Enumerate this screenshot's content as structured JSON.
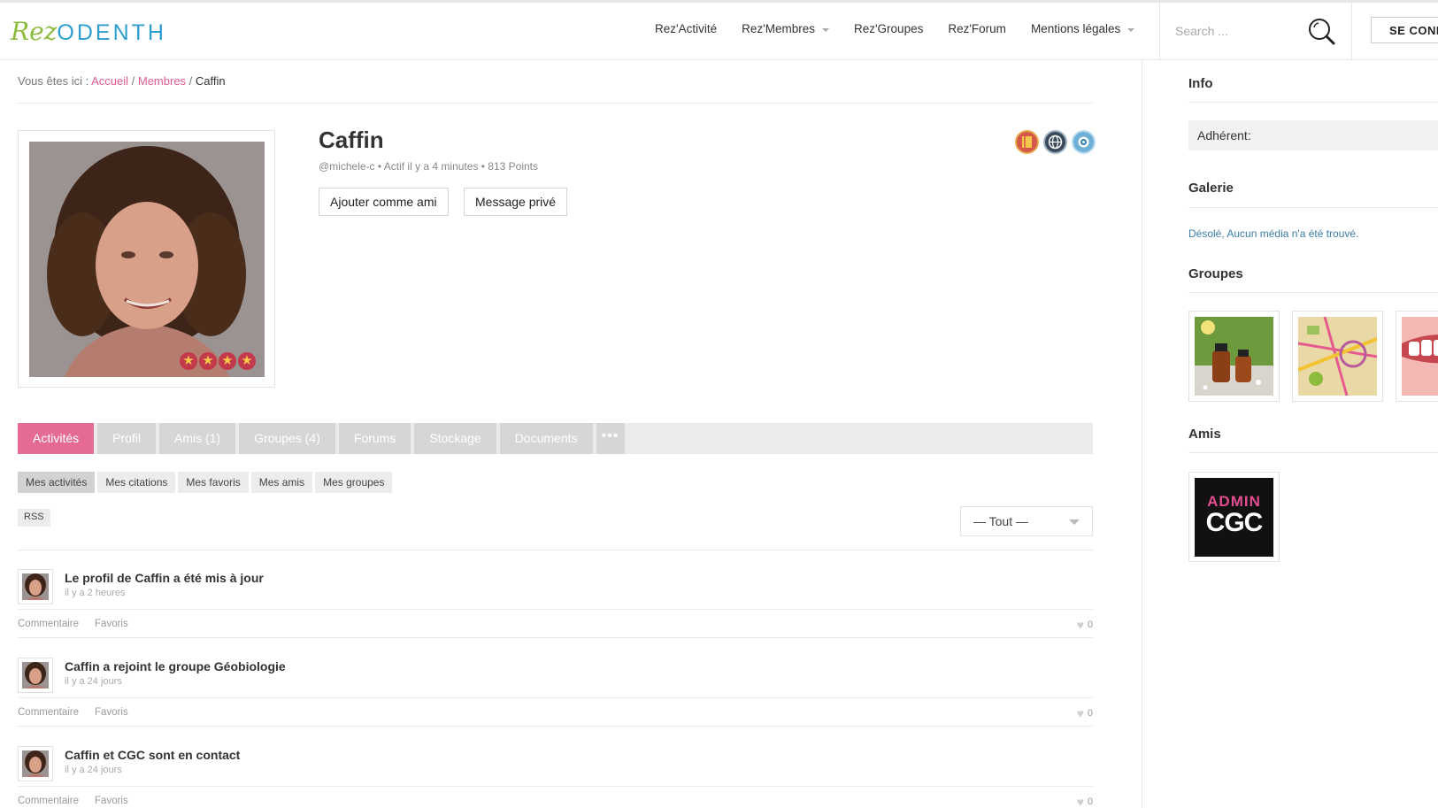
{
  "header": {
    "logo_rez": "Rez",
    "logo_odenth": "ODENTH",
    "nav": [
      {
        "label": "Rez'Activité",
        "dropdown": false
      },
      {
        "label": "Rez'Membres",
        "dropdown": true
      },
      {
        "label": "Rez'Groupes",
        "dropdown": false
      },
      {
        "label": "Rez'Forum",
        "dropdown": false
      },
      {
        "label": "Mentions légales",
        "dropdown": true
      }
    ],
    "search_placeholder": "Search ...",
    "login_label": "SE CONNECTER"
  },
  "breadcrumb": {
    "prefix": "Vous êtes ici : ",
    "home": "Accueil",
    "sep": " / ",
    "members": "Membres",
    "current": "Caffin"
  },
  "profile": {
    "name": "Caffin",
    "meta": "@michele-c • Actif il y a 4 minutes • 813 Points",
    "add_friend": "Ajouter comme ami",
    "private_message": "Message privé",
    "rating_stars": 4,
    "badge_icons": [
      "book-badge-icon",
      "globe-badge-icon",
      "eye-badge-icon"
    ]
  },
  "tabs": [
    {
      "label": "Activités",
      "active": true
    },
    {
      "label": "Profil",
      "active": false
    },
    {
      "label": "Amis (1)",
      "active": false
    },
    {
      "label": "Groupes (4)",
      "active": false
    },
    {
      "label": "Forums",
      "active": false
    },
    {
      "label": "Stockage",
      "active": false
    },
    {
      "label": "Documents",
      "active": false
    },
    {
      "label": "•••",
      "active": false
    }
  ],
  "subtabs": [
    {
      "label": "Mes activités",
      "active": true
    },
    {
      "label": "Mes citations",
      "active": false
    },
    {
      "label": "Mes favoris",
      "active": false
    },
    {
      "label": "Mes amis",
      "active": false
    },
    {
      "label": "Mes groupes",
      "active": false
    }
  ],
  "rss_label": "RSS",
  "filter": {
    "selected": "— Tout —"
  },
  "activities": [
    {
      "title": "Le profil de Caffin a été mis à jour",
      "time": "il y a 2 heures",
      "comment": "Commentaire",
      "favorite": "Favoris",
      "likes": "0"
    },
    {
      "title": "Caffin a rejoint le groupe Géobiologie",
      "time": "il y a 24 jours",
      "comment": "Commentaire",
      "favorite": "Favoris",
      "likes": "0"
    },
    {
      "title": "Caffin et CGC sont en contact",
      "time": "il y a 24 jours",
      "comment": "Commentaire",
      "favorite": "Favoris",
      "likes": "0"
    }
  ],
  "sidebar": {
    "info_title": "Info",
    "info_field": "Adhérent:",
    "gallery_title": "Galerie",
    "gallery_empty": "Désolé, Aucun média n'a été trouvé.",
    "groups_title": "Groupes",
    "friends_title": "Amis",
    "friend_logo_top": "ADMIN",
    "friend_logo_bottom": "CGC"
  },
  "colors": {
    "accent_pink": "#e56b96",
    "link_pink": "#e05a8f",
    "logo_green": "#8dbb3c",
    "logo_blue": "#2e9fcf"
  }
}
